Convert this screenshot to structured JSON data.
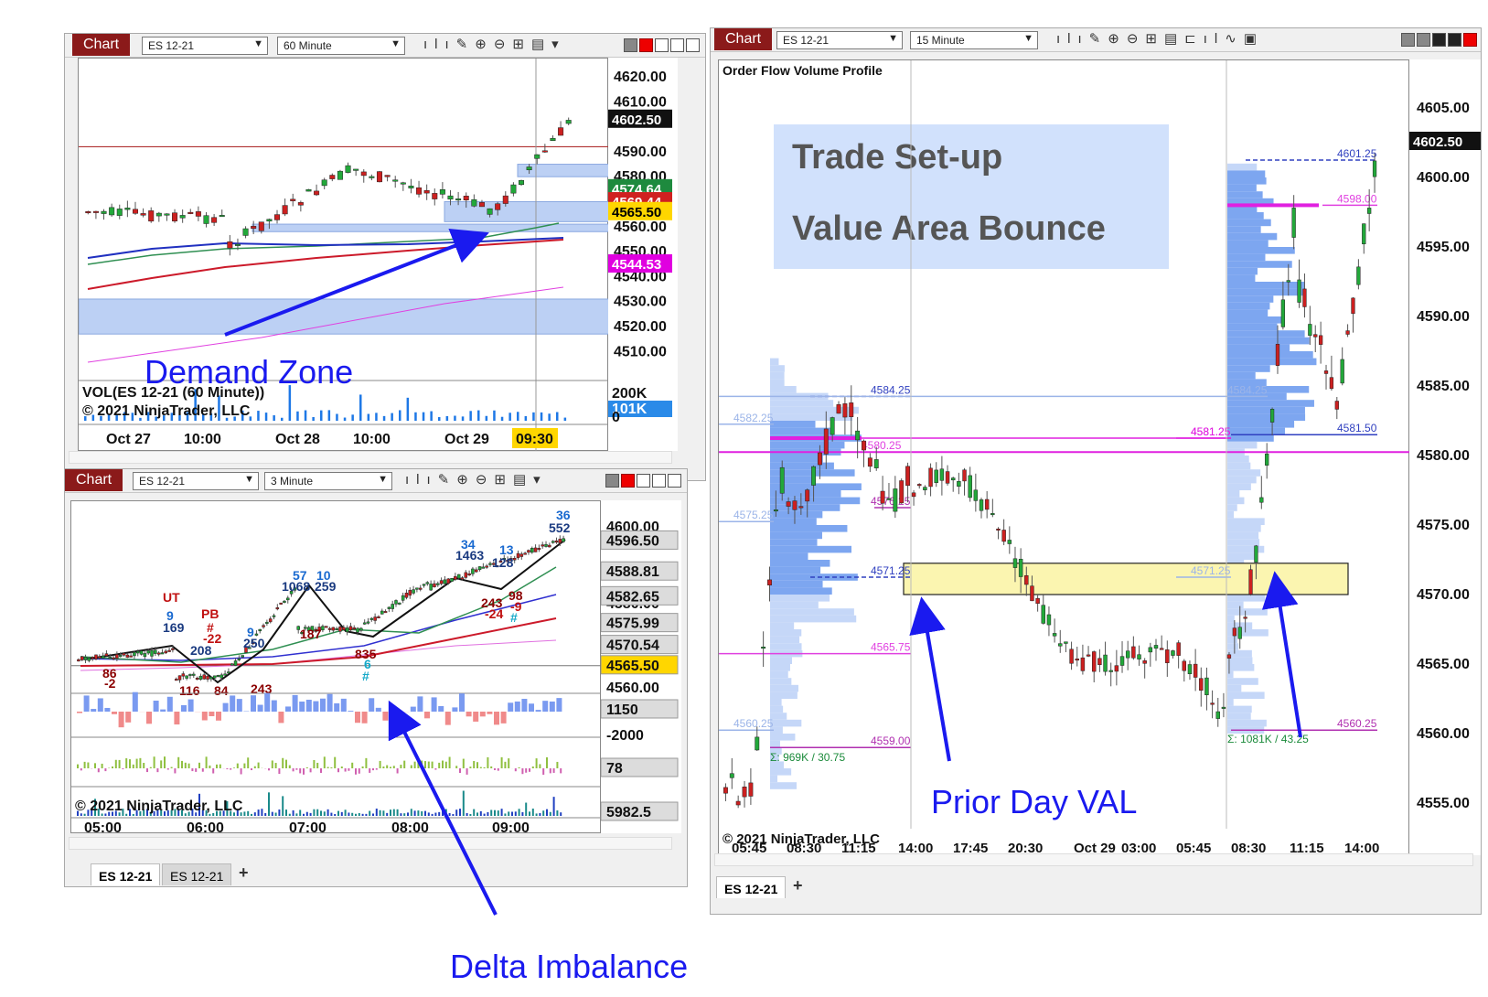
{
  "colors": {
    "up_candle": "#22a83a",
    "down_candle": "#cc2020",
    "annotation": "#1a1aef",
    "chart_button": "#8b1a1a",
    "current_price": "#111111",
    "highlight_price": "#ffd600",
    "volume_profile": "#7da6f0"
  },
  "windows": {
    "top_left": {
      "button": "Chart",
      "instrument": "ES 12-21",
      "interval": "60 Minute",
      "price_ticks": [
        "4620.00",
        "4610.00",
        "4590.00",
        "4580.00",
        "4560.00",
        "4550.00",
        "4540.00",
        "4530.00",
        "4520.00",
        "4510.00"
      ],
      "price_markers": [
        "4602.50",
        "4574.64",
        "4569.44",
        "4565.50",
        "4544.53"
      ],
      "volume_label": "VOL(ES 12-21 (60 Minute))",
      "copyright": "© 2021 NinjaTrader, LLC",
      "volume_axis": [
        "200K",
        "101K",
        "0"
      ],
      "time_labels": [
        "Oct 27",
        "10:00",
        "Oct 28",
        "10:00",
        "Oct 29",
        "09:30"
      ]
    },
    "bottom_left": {
      "button": "Chart",
      "instrument": "ES 12-21",
      "interval": "3 Minute",
      "price_ticks": [
        "4600.00",
        "4580.00"
      ],
      "price_markers": [
        "4596.50",
        "4588.81",
        "4582.65",
        "4575.99",
        "4570.54",
        "4565.50",
        "4560.00"
      ],
      "indicator_values": [
        "1150",
        "-2000",
        "78",
        "5982.5"
      ],
      "copyright": "© 2021 NinjaTrader, LLC",
      "time_labels": [
        "05:00",
        "06:00",
        "07:00",
        "08:00",
        "09:00"
      ],
      "tabs": [
        "ES 12-21",
        "ES 12-21"
      ],
      "swing_labels": [
        {
          "t": "UT",
          "c": "#c01010"
        },
        {
          "t": "9",
          "c": "#1a6ad0"
        },
        {
          "t": "169",
          "c": "#1a3a80"
        },
        {
          "t": "PB",
          "c": "#c01010"
        },
        {
          "t": "#",
          "c": "#c01010"
        },
        {
          "t": "-22",
          "c": "#c01010"
        },
        {
          "t": "208",
          "c": "#1a3a80"
        },
        {
          "t": "86",
          "c": "#8b0000"
        },
        {
          "t": "-2",
          "c": "#8b0000"
        },
        {
          "t": "116",
          "c": "#8b0000"
        },
        {
          "t": "84",
          "c": "#8b0000"
        },
        {
          "t": "9",
          "c": "#1a6ad0"
        },
        {
          "t": "250",
          "c": "#1a3a80"
        },
        {
          "t": "243",
          "c": "#8b0000"
        },
        {
          "t": "57",
          "c": "#1a6ad0"
        },
        {
          "t": "10",
          "c": "#1a6ad0"
        },
        {
          "t": "1068",
          "c": "#1a3a80"
        },
        {
          "t": "259",
          "c": "#1a3a80"
        },
        {
          "t": "187",
          "c": "#8b0000"
        },
        {
          "t": "835",
          "c": "#8b0000"
        },
        {
          "t": "6",
          "c": "#13a8c8"
        },
        {
          "t": "#",
          "c": "#13a8c8"
        },
        {
          "t": "34",
          "c": "#1a6ad0"
        },
        {
          "t": "1463",
          "c": "#1a3a80"
        },
        {
          "t": "13",
          "c": "#1a6ad0"
        },
        {
          "t": "128",
          "c": "#1a3a80"
        },
        {
          "t": "243",
          "c": "#8b0000"
        },
        {
          "t": "-24",
          "c": "#c01010"
        },
        {
          "t": "98",
          "c": "#8b0000"
        },
        {
          "t": "-9",
          "c": "#c01010"
        },
        {
          "t": "#",
          "c": "#13a8c8"
        },
        {
          "t": "36",
          "c": "#1a6ad0"
        },
        {
          "t": "552",
          "c": "#1a3a80"
        }
      ]
    },
    "right": {
      "button": "Chart",
      "instrument": "ES 12-21",
      "interval": "15 Minute",
      "indicator_title": "Order Flow Volume Profile",
      "setup_line1": "Trade Set-up",
      "setup_line2": "Value Area Bounce",
      "price_ticks": [
        "4605.00",
        "4600.00",
        "4595.00",
        "4590.00",
        "4585.00",
        "4580.00",
        "4575.00",
        "4570.00",
        "4565.00",
        "4560.00",
        "4555.00"
      ],
      "price_marker": "4602.50",
      "level_labels": [
        "4582.25",
        "4580.25",
        "4575.25",
        "4584.25",
        "4581.25",
        "4576.25",
        "4571.25",
        "4565.75",
        "4560.25",
        "4559.00",
        "4571.25",
        "4584.25",
        "4581.25",
        "4601.25",
        "4598.00",
        "4581.50",
        "4560.25"
      ],
      "sigma_labels": [
        "Σ: 969K / 30.75",
        "Σ: 1081K / 43.25"
      ],
      "copyright": "© 2021 NinjaTrader, LLC",
      "time_labels": [
        "05:45",
        "08:30",
        "11:15",
        "14:00",
        "17:45",
        "20:30",
        "Oct 29",
        "03:00",
        "05:45",
        "08:30",
        "11:15",
        "14:00"
      ],
      "tabs": [
        "ES 12-21"
      ]
    }
  },
  "annotations": {
    "demand_zone": "Demand Zone",
    "prior_day_val": "Prior Day VAL",
    "delta_imbalance": "Delta Imbalance"
  }
}
